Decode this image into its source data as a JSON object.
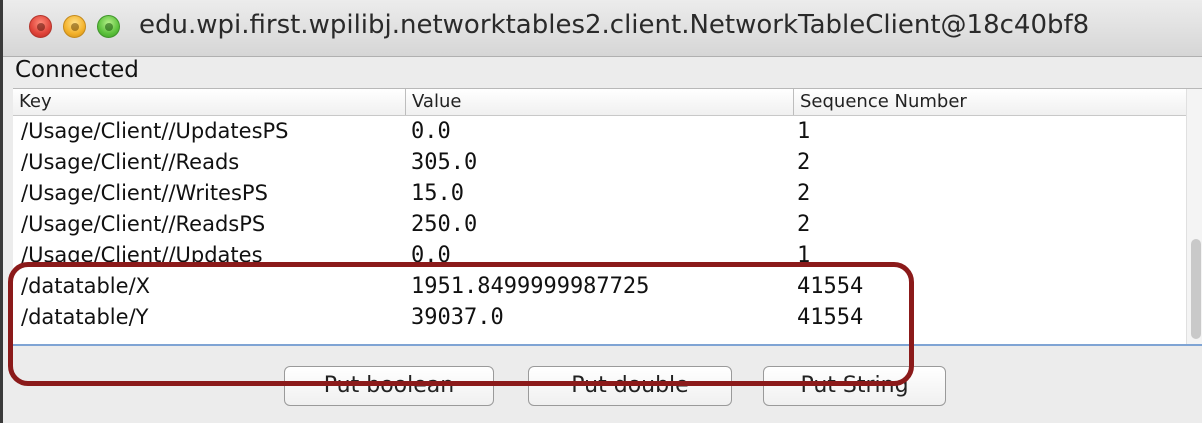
{
  "window": {
    "title": "edu.wpi.first.wpilibj.networktables2.client.NetworkTableClient@18c40bf8",
    "controls": [
      "close-icon",
      "minimize-icon",
      "maximize-icon"
    ]
  },
  "status": "Connected",
  "table": {
    "columns": [
      "Key",
      "Value",
      "Sequence Number"
    ],
    "rows": [
      [
        "/Usage/Client//UpdatesPS",
        "0.0",
        "1"
      ],
      [
        "/Usage/Client//Reads",
        "305.0",
        "2"
      ],
      [
        "/Usage/Client//WritesPS",
        "15.0",
        "2"
      ],
      [
        "/Usage/Client//ReadsPS",
        "250.0",
        "2"
      ],
      [
        "/Usage/Client//Updates",
        "0.0",
        "1"
      ],
      [
        "/datatable/X",
        "1951.8499999987725",
        "41554"
      ],
      [
        "/datatable/Y",
        "39037.0",
        "41554"
      ]
    ]
  },
  "buttons": {
    "put_boolean": "Put boolean",
    "put_double": "Put double",
    "put_string": "Put String"
  },
  "colors": {
    "highlight": "#8b1a1a",
    "close": "#e0443a",
    "minimize": "#f3b12a",
    "maximize": "#5cc13c"
  }
}
